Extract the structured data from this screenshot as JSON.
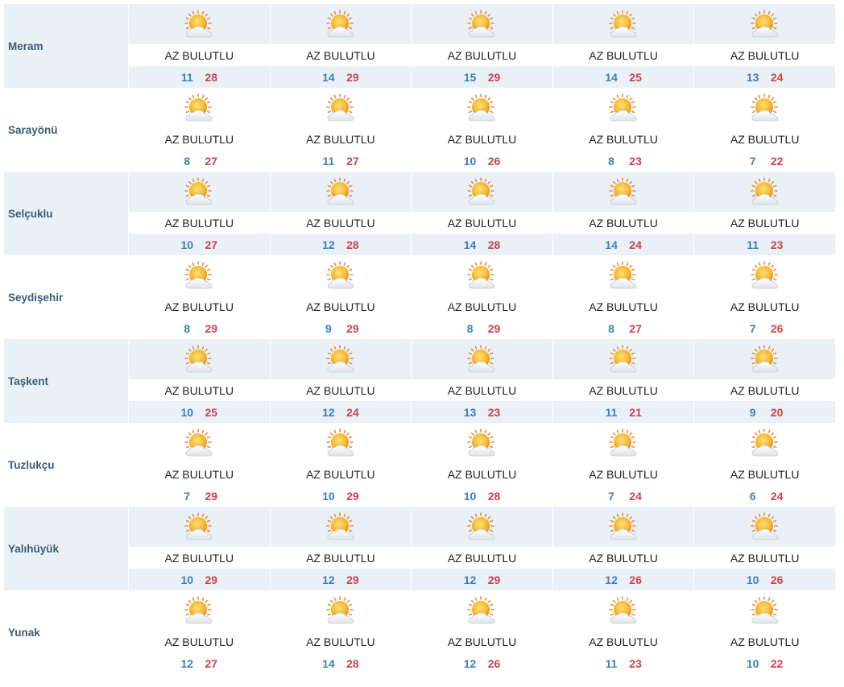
{
  "colors": {
    "low_temp": "#3e7ec0",
    "high_temp": "#d0404a",
    "shade": "#e9f1f6",
    "city_text": "#3e5b75"
  },
  "icon": "sun-behind-cloud-icon",
  "rows": [
    {
      "city": "Meram",
      "days": [
        {
          "desc": "AZ BULUTLU",
          "lo": "11",
          "hi": "28"
        },
        {
          "desc": "AZ BULUTLU",
          "lo": "14",
          "hi": "29"
        },
        {
          "desc": "AZ BULUTLU",
          "lo": "15",
          "hi": "29"
        },
        {
          "desc": "AZ BULUTLU",
          "lo": "14",
          "hi": "25"
        },
        {
          "desc": "AZ BULUTLU",
          "lo": "13",
          "hi": "24"
        }
      ]
    },
    {
      "city": "Sarayönü",
      "days": [
        {
          "desc": "AZ BULUTLU",
          "lo": "8",
          "hi": "27"
        },
        {
          "desc": "AZ BULUTLU",
          "lo": "11",
          "hi": "27"
        },
        {
          "desc": "AZ BULUTLU",
          "lo": "10",
          "hi": "26"
        },
        {
          "desc": "AZ BULUTLU",
          "lo": "8",
          "hi": "23"
        },
        {
          "desc": "AZ BULUTLU",
          "lo": "7",
          "hi": "22"
        }
      ]
    },
    {
      "city": "Selçuklu",
      "days": [
        {
          "desc": "AZ BULUTLU",
          "lo": "10",
          "hi": "27"
        },
        {
          "desc": "AZ BULUTLU",
          "lo": "12",
          "hi": "28"
        },
        {
          "desc": "AZ BULUTLU",
          "lo": "14",
          "hi": "28"
        },
        {
          "desc": "AZ BULUTLU",
          "lo": "14",
          "hi": "24"
        },
        {
          "desc": "AZ BULUTLU",
          "lo": "11",
          "hi": "23"
        }
      ]
    },
    {
      "city": "Seydişehir",
      "days": [
        {
          "desc": "AZ BULUTLU",
          "lo": "8",
          "hi": "29"
        },
        {
          "desc": "AZ BULUTLU",
          "lo": "9",
          "hi": "29"
        },
        {
          "desc": "AZ BULUTLU",
          "lo": "8",
          "hi": "29"
        },
        {
          "desc": "AZ BULUTLU",
          "lo": "8",
          "hi": "27"
        },
        {
          "desc": "AZ BULUTLU",
          "lo": "7",
          "hi": "26"
        }
      ]
    },
    {
      "city": "Taşkent",
      "days": [
        {
          "desc": "AZ BULUTLU",
          "lo": "10",
          "hi": "25"
        },
        {
          "desc": "AZ BULUTLU",
          "lo": "12",
          "hi": "24"
        },
        {
          "desc": "AZ BULUTLU",
          "lo": "13",
          "hi": "23"
        },
        {
          "desc": "AZ BULUTLU",
          "lo": "11",
          "hi": "21"
        },
        {
          "desc": "AZ BULUTLU",
          "lo": "9",
          "hi": "20"
        }
      ]
    },
    {
      "city": "Tuzlukçu",
      "days": [
        {
          "desc": "AZ BULUTLU",
          "lo": "7",
          "hi": "29"
        },
        {
          "desc": "AZ BULUTLU",
          "lo": "10",
          "hi": "29"
        },
        {
          "desc": "AZ BULUTLU",
          "lo": "10",
          "hi": "28"
        },
        {
          "desc": "AZ BULUTLU",
          "lo": "7",
          "hi": "24"
        },
        {
          "desc": "AZ BULUTLU",
          "lo": "6",
          "hi": "24"
        }
      ]
    },
    {
      "city": "Yalıhüyük",
      "days": [
        {
          "desc": "AZ BULUTLU",
          "lo": "10",
          "hi": "29"
        },
        {
          "desc": "AZ BULUTLU",
          "lo": "12",
          "hi": "29"
        },
        {
          "desc": "AZ BULUTLU",
          "lo": "12",
          "hi": "29"
        },
        {
          "desc": "AZ BULUTLU",
          "lo": "12",
          "hi": "26"
        },
        {
          "desc": "AZ BULUTLU",
          "lo": "10",
          "hi": "26"
        }
      ]
    },
    {
      "city": "Yunak",
      "days": [
        {
          "desc": "AZ BULUTLU",
          "lo": "12",
          "hi": "27"
        },
        {
          "desc": "AZ BULUTLU",
          "lo": "14",
          "hi": "28"
        },
        {
          "desc": "AZ BULUTLU",
          "lo": "12",
          "hi": "26"
        },
        {
          "desc": "AZ BULUTLU",
          "lo": "11",
          "hi": "23"
        },
        {
          "desc": "AZ BULUTLU",
          "lo": "10",
          "hi": "22"
        }
      ]
    }
  ]
}
